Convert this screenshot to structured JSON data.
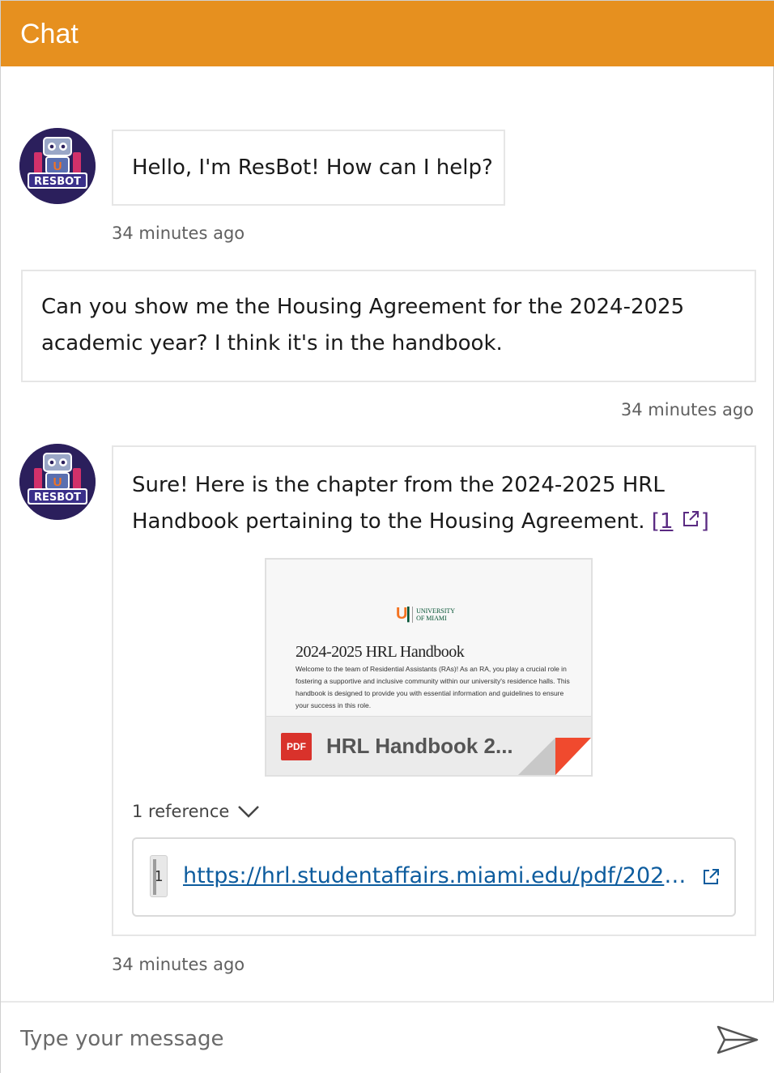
{
  "header": {
    "title": "Chat"
  },
  "messages": [
    {
      "sender": "bot",
      "text": "Hello, I'm ResBot! How can I help?",
      "timestamp": "34 minutes ago"
    },
    {
      "sender": "user",
      "text_line1": "Can you show me the Housing Agreement for the 2024-2025",
      "text_line2": "academic year? I think it's in the handbook.",
      "timestamp": "34 minutes ago"
    },
    {
      "sender": "bot",
      "text_line1": "Sure! Here is the chapter from the 2024-2025 HRL",
      "text_line2": "Handbook pertaining to the Housing Agreement.",
      "citation_open": "[",
      "citation_num": "1",
      "citation_close": "]",
      "attachment": {
        "logo_line1": "UNIVERSITY",
        "logo_line2": "OF MIAMI",
        "preview_title": "2024-2025 HRL Handbook",
        "preview_body": "Welcome to the team of Residential Assistants (RAs)! As an RA, you play a crucial role in fostering a supportive and inclusive community within our university's residence halls. This handbook is designed to provide you with essential information and guidelines to ensure your success in this role.",
        "file_type": "PDF",
        "name": "HRL Handbook 2..."
      },
      "references_label": "1 reference",
      "references": [
        {
          "num": "1",
          "url": "https://hrl.studentaffairs.miami.edu/pdf/2024-..."
        }
      ],
      "timestamp": "34 minutes ago"
    }
  ],
  "avatar": {
    "label": "RESBOT",
    "letter": "U"
  },
  "composer": {
    "placeholder": "Type your message"
  },
  "colors": {
    "header": "#e6901f",
    "citation": "#5a2a82",
    "link": "#0d5c9e",
    "pdf": "#d9322b",
    "avatar_bg": "#2b1f5c"
  }
}
